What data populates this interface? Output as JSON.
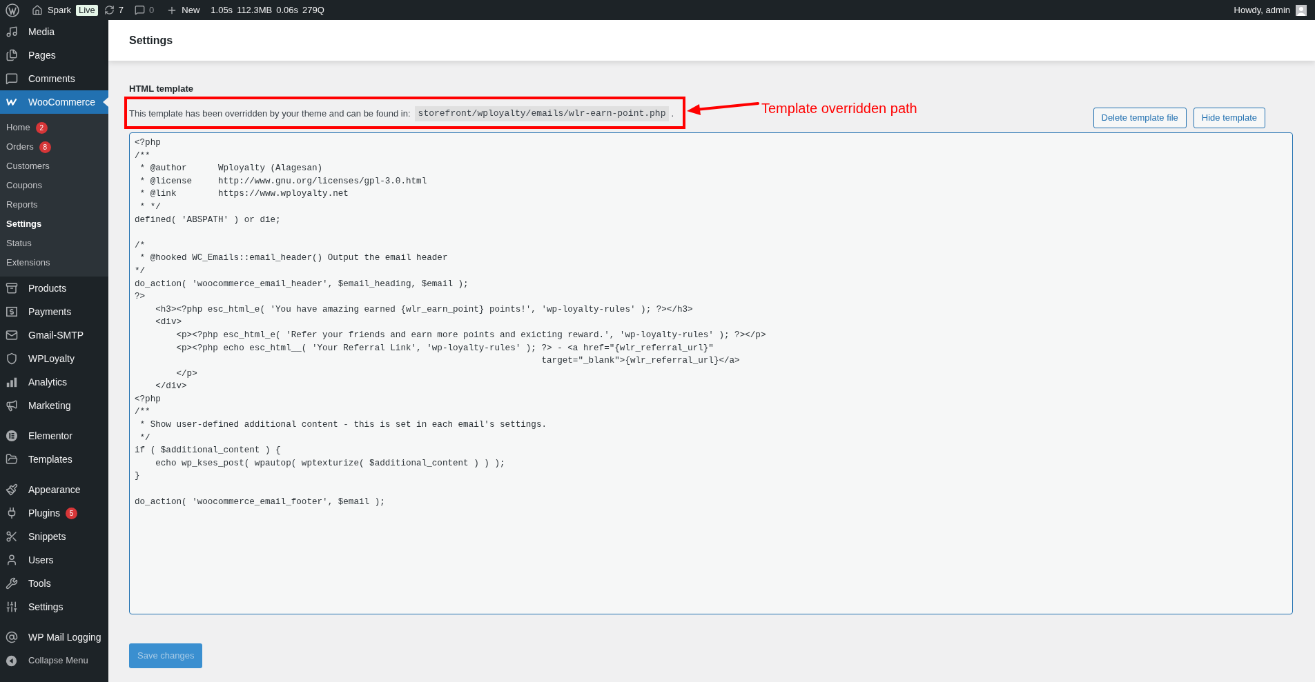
{
  "admin_bar": {
    "site": "Spark",
    "live_badge": "Live",
    "updates": "7",
    "comments": "0",
    "new": "New",
    "stats": [
      "1.05s",
      "112.3MB",
      "0.06s",
      "279Q"
    ],
    "greeting": "Howdy, admin"
  },
  "sidebar": {
    "items": [
      {
        "label": "Media",
        "selected": false
      },
      {
        "label": "Pages",
        "selected": false
      },
      {
        "label": "Comments",
        "selected": false
      },
      {
        "label": "WooCommerce",
        "selected": true,
        "children": [
          {
            "label": "Home",
            "badge": "2",
            "selected": false
          },
          {
            "label": "Orders",
            "badge": "8",
            "selected": false
          },
          {
            "label": "Customers",
            "selected": false
          },
          {
            "label": "Coupons",
            "selected": false
          },
          {
            "label": "Reports",
            "selected": false
          },
          {
            "label": "Settings",
            "selected": true
          },
          {
            "label": "Status",
            "selected": false
          },
          {
            "label": "Extensions",
            "selected": false
          }
        ]
      },
      {
        "label": "Products",
        "selected": false
      },
      {
        "label": "Payments",
        "selected": false
      },
      {
        "label": "Gmail-SMTP",
        "selected": false
      },
      {
        "label": "WPLoyalty",
        "selected": false
      },
      {
        "label": "Analytics",
        "selected": false
      },
      {
        "label": "Marketing",
        "selected": false
      },
      {
        "label": "Elementor",
        "selected": false
      },
      {
        "label": "Templates",
        "selected": false
      },
      {
        "label": "Appearance",
        "selected": false
      },
      {
        "label": "Plugins",
        "badge": "5",
        "selected": false
      },
      {
        "label": "Snippets",
        "selected": false
      },
      {
        "label": "Users",
        "selected": false
      },
      {
        "label": "Tools",
        "selected": false
      },
      {
        "label": "Settings",
        "selected": false
      },
      {
        "label": "WP Mail Logging",
        "selected": false
      }
    ],
    "collapse": "Collapse Menu"
  },
  "page_title": "Settings",
  "section_title": "HTML template",
  "override_notice": {
    "text": "This template has been overridden by your theme and can be found in:",
    "path": "storefront/wployalty/emails/wlr-earn-point.php",
    "suffix": "."
  },
  "buttons": [
    "Delete template file",
    "Hide template"
  ],
  "code": "<?php\n/**\n * @author      Wployalty (Alagesan)\n * @license     http://www.gnu.org/licenses/gpl-3.0.html\n * @link        https://www.wployalty.net\n * */\ndefined( 'ABSPATH' ) or die;\n\n/*\n * @hooked WC_Emails::email_header() Output the email header\n*/\ndo_action( 'woocommerce_email_header', $email_heading, $email );\n?>\n    <h3><?php esc_html_e( 'You have amazing earned {wlr_earn_point} points!', 'wp-loyalty-rules' ); ?></h3>\n    <div>\n        <p><?php esc_html_e( 'Refer your friends and earn more points and exicting reward.', 'wp-loyalty-rules' ); ?></p>\n        <p><?php echo esc_html__( 'Your Referral Link', 'wp-loyalty-rules' ); ?> - <a href=\"{wlr_referral_url}\"\n                                                                              target=\"_blank\">{wlr_referral_url}</a>\n        </p>\n    </div>\n<?php\n/**\n * Show user-defined additional content - this is set in each email's settings.\n */\nif ( $additional_content ) {\n    echo wp_kses_post( wpautop( wptexturize( $additional_content ) ) );\n}\n\ndo_action( 'woocommerce_email_footer', $email );",
  "save_button": {
    "label": "Save changes",
    "disabled": true
  },
  "annotation": {
    "label": "Template overridden path"
  }
}
